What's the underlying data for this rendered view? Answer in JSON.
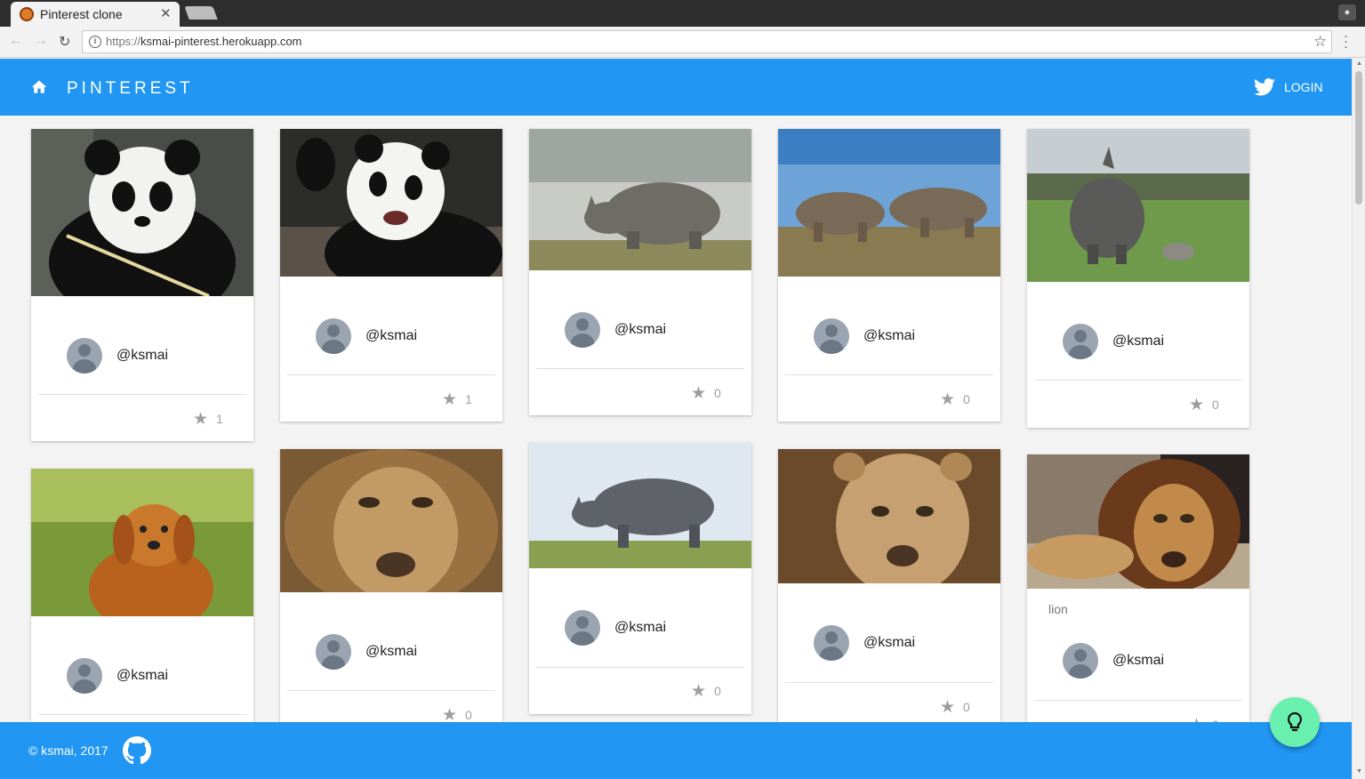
{
  "browser": {
    "tab_title": "Pinterest clone",
    "tab_close": "✕",
    "url_scheme": "https://",
    "url_host": "ksmai-pinterest.herokuapp.com"
  },
  "header": {
    "brand": "PINTEREST",
    "login_label": "LOGIN"
  },
  "cards": [
    {
      "caption": "",
      "user": "@ksmai",
      "stars": "1",
      "image": "panda"
    },
    {
      "caption": "",
      "user": "@ksmai",
      "stars": "1",
      "image": "panda"
    },
    {
      "caption": "",
      "user": "@ksmai",
      "stars": "0",
      "image": "rhino"
    },
    {
      "caption": "",
      "user": "@ksmai",
      "stars": "0",
      "image": "rhinos"
    },
    {
      "caption": "",
      "user": "@ksmai",
      "stars": "0",
      "image": "rhino"
    },
    {
      "caption": "",
      "user": "@ksmai",
      "stars": "",
      "image": "dog"
    },
    {
      "caption": "",
      "user": "@ksmai",
      "stars": "0",
      "image": "lion"
    },
    {
      "caption": "",
      "user": "@ksmai",
      "stars": "0",
      "image": "rhino"
    },
    {
      "caption": "",
      "user": "@ksmai",
      "stars": "0",
      "image": "lioness"
    },
    {
      "caption": "lion",
      "user": "@ksmai",
      "stars": "0",
      "image": "lion"
    }
  ],
  "footer": {
    "copyright": "© ksmai, 2017"
  },
  "colors": {
    "primary": "#2196f3",
    "fab": "#69f0ae"
  }
}
